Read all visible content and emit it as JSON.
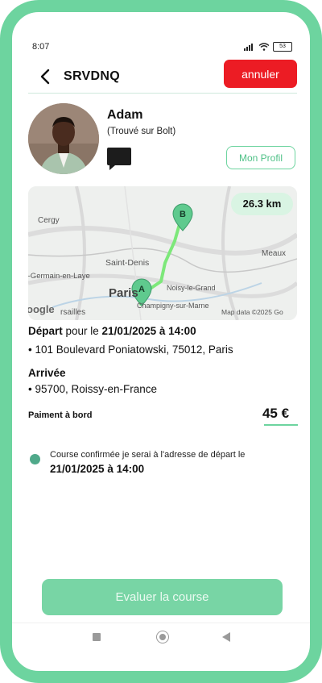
{
  "status_bar": {
    "time": "8:07",
    "battery": "53"
  },
  "header": {
    "ride_code": "SRVDNQ",
    "cancel_label": "annuler"
  },
  "driver": {
    "name": "Adam",
    "source": "(Trouvé sur Bolt)",
    "profile_label": "Mon Profil"
  },
  "map": {
    "distance": "26.3 km",
    "markers": [
      "A",
      "B"
    ],
    "places": [
      "Cergy",
      "Saint-Denis",
      "t-Germain-en-Laye",
      "Paris",
      "Noisy-le-Grand",
      "Champigny-sur-Marne",
      "Meaux",
      "rsailles"
    ],
    "logo": "oogle",
    "attribution": "Map data ©2025 Go",
    "route_color": "#7de87a",
    "marker_color": "#5fca8e"
  },
  "trip": {
    "depart_label": "Départ",
    "depart_prefix": " pour le ",
    "depart_datetime": "21/01/2025 à 14:00",
    "depart_address": "• 101 Boulevard Poniatowski, 75012, Paris",
    "arrive_label": "Arrivée",
    "arrive_address": "• 95700, Roissy-en-France"
  },
  "payment": {
    "label": "Paiment à bord",
    "price": "45 €"
  },
  "confirmation": {
    "text": "Course confirmée je serai à l'adresse de départ le",
    "datetime": "21/01/2025 à 14:00"
  },
  "actions": {
    "rate_label": "Evaluer la course"
  },
  "colors": {
    "accent": "#6dd49f",
    "cancel": "#ec1c24",
    "button": "#78d5a5"
  }
}
